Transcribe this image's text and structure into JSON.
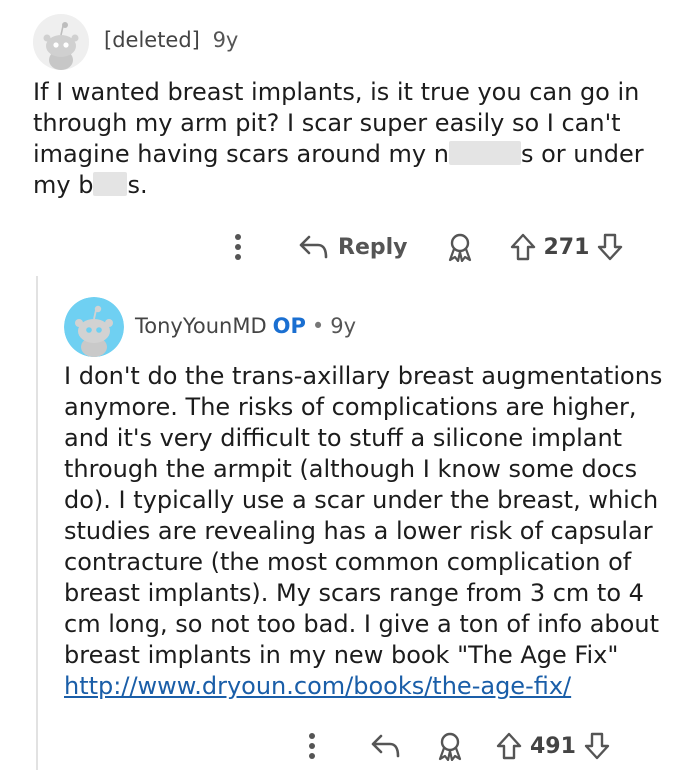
{
  "parent": {
    "author": "[deleted]",
    "age": "9y",
    "text_pre": "If I wanted breast implants, is it true you can go in through my arm pit? I scar super easily so I can't imagine having scars around my n",
    "text_mid": "s or under my b",
    "text_end": "s.",
    "reply_label": "Reply",
    "votes": "271"
  },
  "child": {
    "author": "TonyYounMD",
    "op_label": "OP",
    "separator": "•",
    "age": "9y",
    "text": "I don't do the trans-axillary breast augmentations anymore. The risks of complications are higher, and it's very difficult to stuff a silicone implant through the armpit (although I know some docs do). I typically use a scar under the breast, which studies are revealing has a lower risk of capsular contracture (the most common complication of breast implants). My scars range from 3 cm to 4 cm long, so not too bad. I give a ton of info about breast implants in my new book \"The Age Fix\"",
    "link": "http://www.dryoun.com/books/the-age-fix/",
    "votes": "491"
  },
  "icons": {
    "more": "more-options-icon",
    "reply": "reply-arrow-icon",
    "award": "award-icon",
    "upvote": "upvote-arrow-icon",
    "downvote": "downvote-arrow-icon",
    "avatar": "snoo-avatar-icon"
  },
  "colors": {
    "op": "#1a6fd1",
    "link": "#1a5ea8",
    "avatar_child_bg": "#6fd0f2",
    "icon": "#555555"
  }
}
